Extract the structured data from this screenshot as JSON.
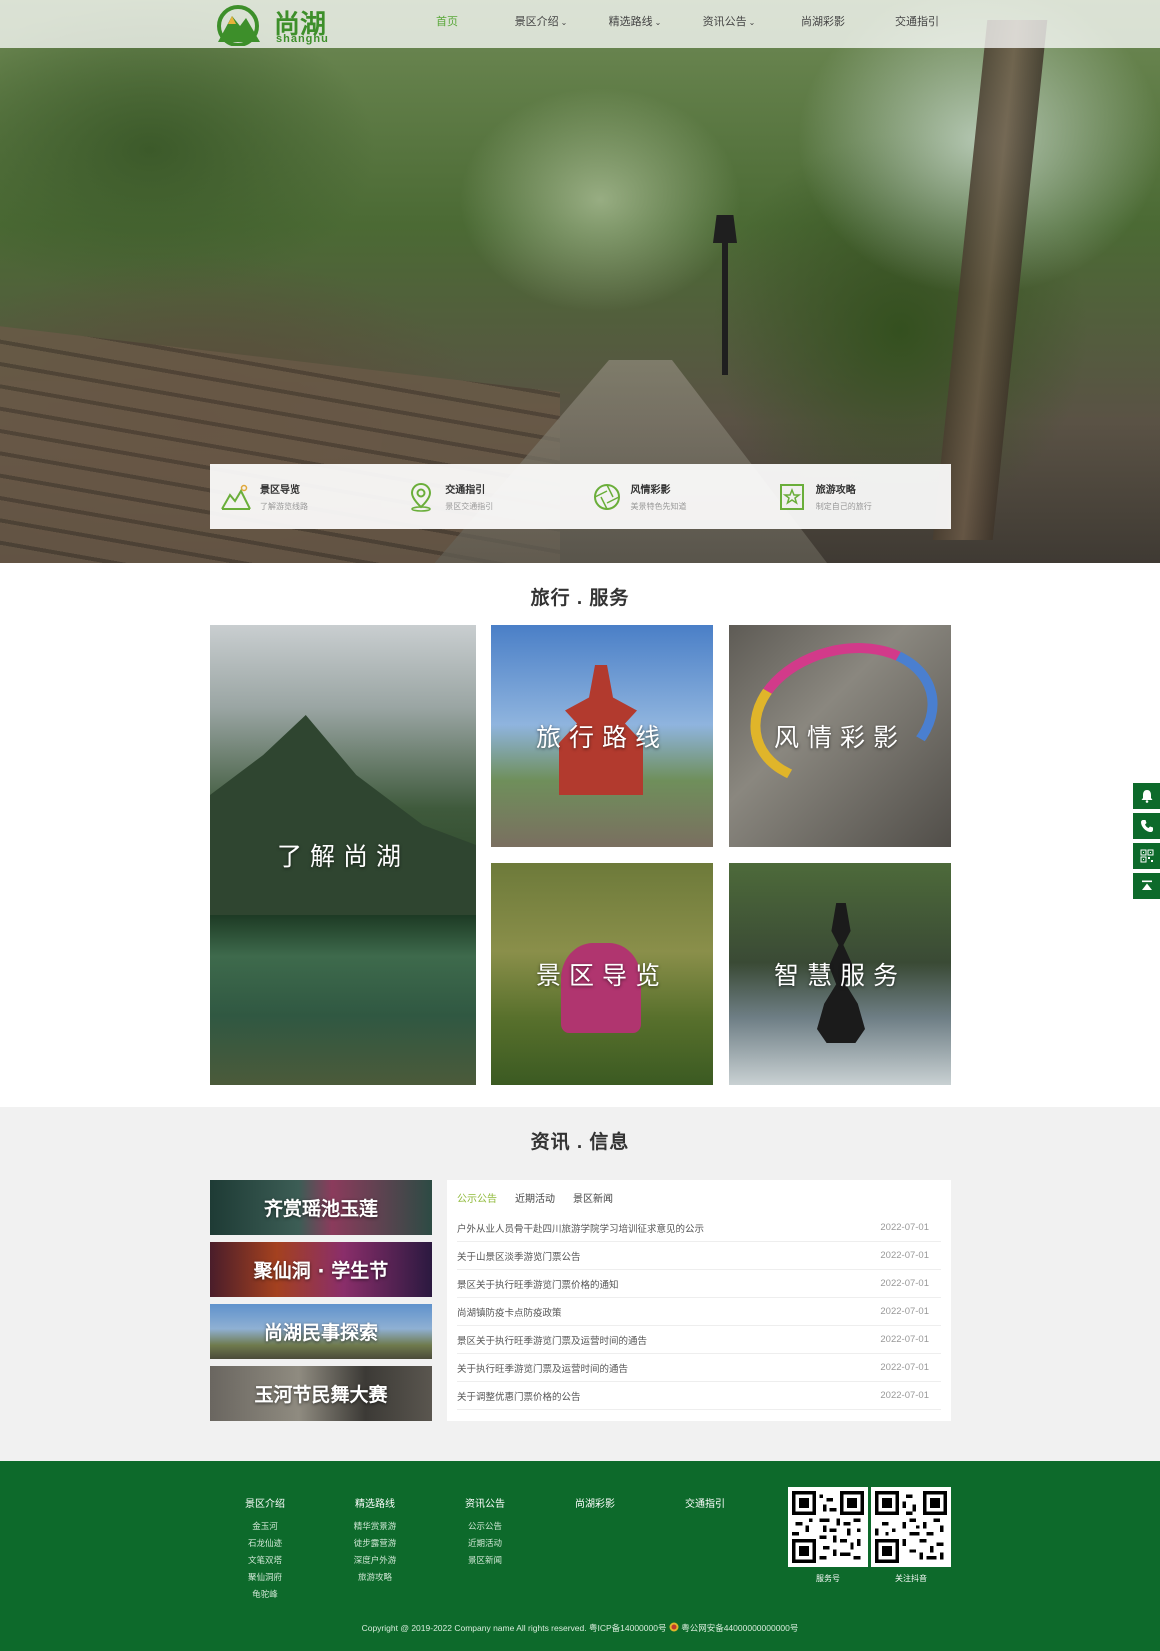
{
  "brand": {
    "name_cn": "尚湖",
    "name_en": "shanghu"
  },
  "nav": {
    "items": [
      {
        "label": "首页",
        "caret": ""
      },
      {
        "label": "景区介绍",
        "caret": "⌄"
      },
      {
        "label": "精选路线",
        "caret": "⌄"
      },
      {
        "label": "资讯公告",
        "caret": "⌄"
      },
      {
        "label": "尚湖彩影",
        "caret": ""
      },
      {
        "label": "交通指引",
        "caret": ""
      }
    ]
  },
  "quick": [
    {
      "title": "景区导览",
      "sub": "了解游览线路",
      "icon": "mountain-icon"
    },
    {
      "title": "交通指引",
      "sub": "景区交通指引",
      "icon": "location-pin-icon"
    },
    {
      "title": "风情彩影",
      "sub": "美景特色先知道",
      "icon": "aperture-icon"
    },
    {
      "title": "旅游攻略",
      "sub": "制定自己的旅行",
      "icon": "star-badge-icon"
    }
  ],
  "services": {
    "title": "旅行 . 服务",
    "tiles": [
      "了解尚湖",
      "旅行路线",
      "风情彩影",
      "景区导览",
      "智慧服务"
    ]
  },
  "news": {
    "title": "资讯 . 信息",
    "banners": [
      "齐赏瑶池玉莲",
      "聚仙洞 · 学生节",
      "尚湖民事探索",
      "玉河节民舞大赛"
    ],
    "tabs": [
      "公示公告",
      "近期活动",
      "景区新闻"
    ],
    "rows": [
      {
        "title": "户外从业人员骨干赴四川旅游学院学习培训征求意见的公示",
        "date": "2022-07-01"
      },
      {
        "title": "关于山景区淡季游览门票公告",
        "date": "2022-07-01"
      },
      {
        "title": "景区关于执行旺季游览门票价格的通知",
        "date": "2022-07-01"
      },
      {
        "title": "尚湖镇防疫卡点防疫政策",
        "date": "2022-07-01"
      },
      {
        "title": "景区关于执行旺季游览门票及运营时间的通告",
        "date": "2022-07-01"
      },
      {
        "title": "关于执行旺季游览门票及运营时间的通告",
        "date": "2022-07-01"
      },
      {
        "title": "关于调整优惠门票价格的公告",
        "date": "2022-07-01"
      }
    ]
  },
  "footer": {
    "columns": [
      {
        "heading": "景区介绍",
        "links": [
          "金玉河",
          "石龙仙迹",
          "文笔双塔",
          "聚仙洞府",
          "龟驼峰"
        ]
      },
      {
        "heading": "精选路线",
        "links": [
          "精华赏景游",
          "徒步露营游",
          "深度户外游",
          "旅游攻略"
        ]
      },
      {
        "heading": "资讯公告",
        "links": [
          "公示公告",
          "近期活动",
          "景区新闻"
        ]
      },
      {
        "heading": "尚湖彩影",
        "links": []
      },
      {
        "heading": "交通指引",
        "links": []
      }
    ],
    "qr": [
      {
        "caption": "服务号"
      },
      {
        "caption": "关注抖音"
      }
    ],
    "copyright": "Copyright @ 2019-2022 Company name All rights reserved.   粤ICP备14000000号   ",
    "police": "粤公网安备44000000000000号"
  },
  "colors": {
    "brand_green": "#0d6a2b",
    "accent_green": "#5aa83a",
    "news_tab_active": "#8fba3a"
  },
  "side_tools": [
    "bell-icon",
    "phone-icon",
    "qrcode-icon",
    "back-to-top-icon"
  ]
}
